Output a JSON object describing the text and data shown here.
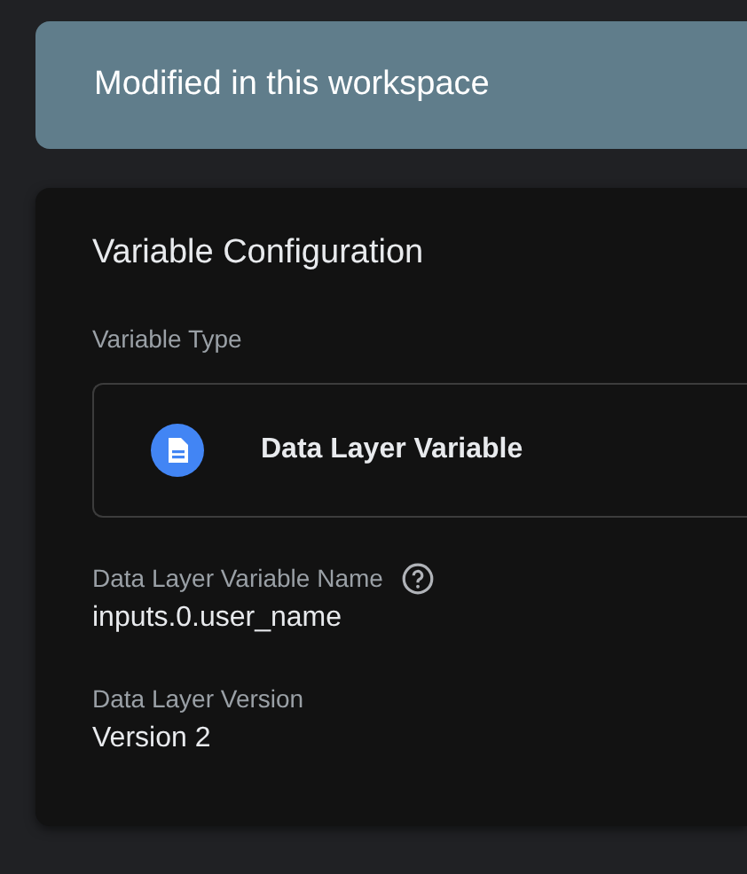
{
  "banner": {
    "text": "Modified in this workspace"
  },
  "card": {
    "title": "Variable Configuration",
    "type_label": "Variable Type",
    "type_value": "Data Layer Variable",
    "fields": [
      {
        "label": "Data Layer Variable Name",
        "help": true,
        "value": "inputs.0.user_name"
      },
      {
        "label": "Data Layer Version",
        "help": false,
        "value": "Version 2"
      }
    ]
  }
}
